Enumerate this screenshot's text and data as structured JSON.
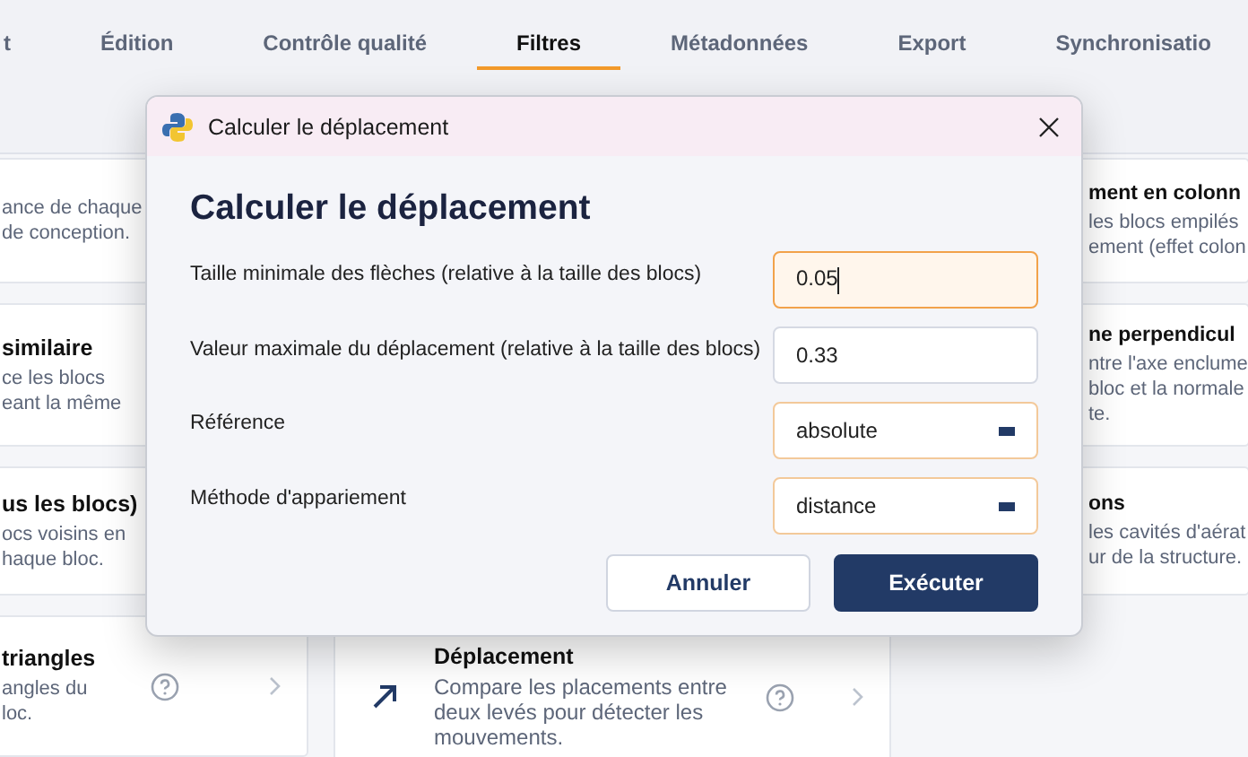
{
  "tabs": [
    {
      "label": "t",
      "selected": false
    },
    {
      "label": "Édition",
      "selected": false
    },
    {
      "label": "Contrôle qualité",
      "selected": false
    },
    {
      "label": "Filtres",
      "selected": true
    },
    {
      "label": "Métadonnées",
      "selected": false
    },
    {
      "label": "Export",
      "selected": false
    },
    {
      "label": "Synchronisatio",
      "selected": false
    }
  ],
  "left_cards": [
    {
      "lines": [
        "ance de chaque",
        "de conception."
      ]
    },
    {
      "title": "similaire",
      "lines": [
        "ce les blocs",
        "eant la même"
      ]
    },
    {
      "title": "us les blocs)",
      "lines": [
        "ocs voisins en",
        "haque bloc."
      ]
    },
    {
      "title": "triangles",
      "lines": [
        "angles du",
        "loc."
      ],
      "help": true
    }
  ],
  "middle_cards": [
    {
      "title": "Déplacement",
      "description": "Compare les placements entre deux levés pour détecter les mouvements.",
      "help": true
    }
  ],
  "right_cards": [
    {
      "title": "ment en colonn",
      "lines": [
        "les blocs empilés",
        "ement (effet colon"
      ]
    },
    {
      "title": "ne perpendicul",
      "lines": [
        "ntre l'axe enclume",
        "bloc et la normale",
        "te."
      ]
    },
    {
      "title": "ons",
      "lines": [
        "les cavités d'aérat",
        "ur de la structure."
      ]
    }
  ],
  "dialog": {
    "title": "Calculer le déplacement",
    "heading": "Calculer le déplacement",
    "fields": [
      {
        "kind": "text",
        "label": "Taille minimale des flèches (relative à la taille des blocs)",
        "value": "0.05",
        "focused": true
      },
      {
        "kind": "text",
        "label": "Valeur maximale du déplacement (relative à la taille des blocs)",
        "value": "0.33",
        "focused": false
      },
      {
        "kind": "select",
        "label": "Référence",
        "value": "absolute",
        "focused": false
      },
      {
        "kind": "select",
        "label": "Méthode d'appariement",
        "value": "distance",
        "focused": false
      }
    ],
    "cancel": "Annuler",
    "submit": "Exécuter"
  }
}
